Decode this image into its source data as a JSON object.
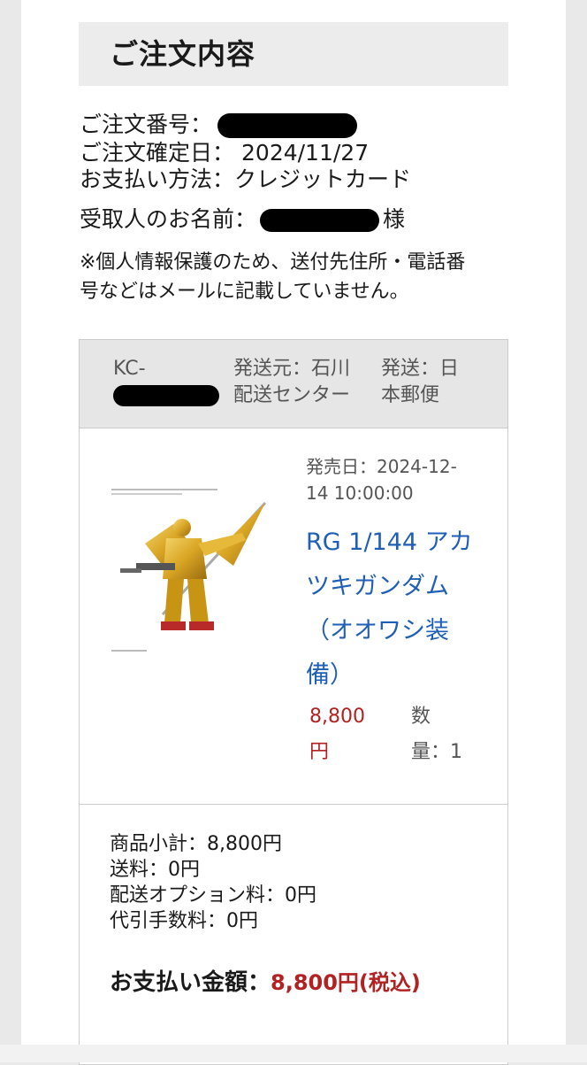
{
  "order": {
    "heading": "ご注文内容",
    "number_label": "ご注文番号：",
    "date_label": "ご注文確定日：",
    "date_value": "2024/11/27",
    "payment_label": "お支払い方法：",
    "payment_value": "クレジットカード",
    "recipient_label": "受取人のお名前：",
    "recipient_suffix": "様",
    "notice_line1": "※個人情報保護のため、送付先住所・電話番",
    "notice_line2": "号などはメールに記載していません。"
  },
  "shipment": {
    "id_prefix": "KC-",
    "origin_line1": "発送元：石川",
    "origin_line2": "配送センター",
    "carrier_line1": "発送：日",
    "carrier_line2": "本郵便"
  },
  "product": {
    "release_line1": "発売日：2024-12-",
    "release_line2": "14 10:00:00",
    "title_line1": "RG 1/144 アカ",
    "title_line2": "ツキガンダム",
    "title_line3": "（オオワシ装",
    "title_line4": "備）",
    "price_line1": "8,800",
    "price_line2": "円",
    "qty_line1": "数",
    "qty_line2": "量：1",
    "image_icon": "gundam-model-image"
  },
  "summary": {
    "subtotal": "商品小計：8,800円",
    "shipping": "送料：0円",
    "delivery_option": "配送オプション料：0円",
    "cod_fee": "代引手数料：0円",
    "total_label": "お支払い金額：",
    "total_value": "8,800円(税込)"
  },
  "colors": {
    "link": "#1f5fb6",
    "price": "#b22222",
    "heading_bg": "#ececec",
    "card_head_bg": "#e6e6e6"
  }
}
